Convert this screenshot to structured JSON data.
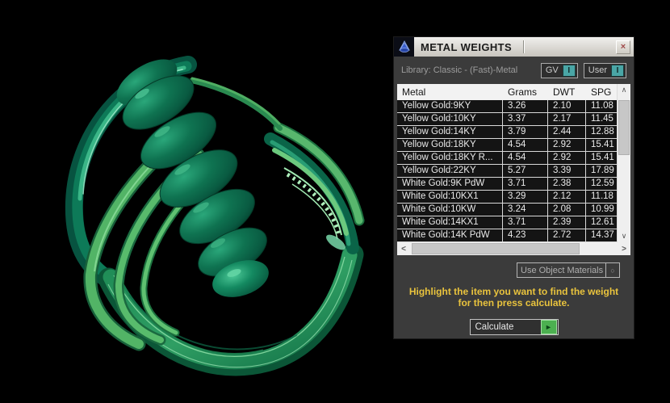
{
  "window": {
    "title": "METAL WEIGHTS"
  },
  "icons": {
    "close": "×",
    "scroll_up": "∧",
    "scroll_down": "∨",
    "scroll_left": "<",
    "scroll_right": ">",
    "dropdown_circle": "○",
    "play": "►",
    "gv_indicator": "I",
    "user_indicator": "I"
  },
  "library": {
    "label": "Library: Classic - (Fast)-Metal"
  },
  "toggles": [
    {
      "label": "GV"
    },
    {
      "label": "User"
    }
  ],
  "table": {
    "columns": [
      "Metal",
      "Grams",
      "DWT",
      "SPG"
    ],
    "rows": [
      [
        "Yellow Gold:9KY",
        "3.26",
        "2.10",
        "11.08"
      ],
      [
        "Yellow Gold:10KY",
        "3.37",
        "2.17",
        "11.45"
      ],
      [
        "Yellow Gold:14KY",
        "3.79",
        "2.44",
        "12.88"
      ],
      [
        "Yellow Gold:18KY",
        "4.54",
        "2.92",
        "15.41"
      ],
      [
        "Yellow Gold:18KY R...",
        "4.54",
        "2.92",
        "15.41"
      ],
      [
        "Yellow Gold:22KY",
        "5.27",
        "3.39",
        "17.89"
      ],
      [
        "White Gold:9K PdW",
        "3.71",
        "2.38",
        "12.59"
      ],
      [
        "White Gold:10KX1",
        "3.29",
        "2.12",
        "11.18"
      ],
      [
        "White Gold:10KW",
        "3.24",
        "2.08",
        "10.99"
      ],
      [
        "White Gold:14KX1",
        "3.71",
        "2.39",
        "12.61"
      ],
      [
        "White Gold:14K PdW",
        "4.23",
        "2.72",
        "14.37"
      ]
    ]
  },
  "materials_dropdown": {
    "value": "Use Object Materials"
  },
  "instruction": {
    "line1": "Highlight the item you want to find the weight",
    "line2": "for then press calculate."
  },
  "calculate_button": {
    "label": "Calculate"
  },
  "model": {
    "description": "green 3D ring CAD render",
    "primary_color": "#0e7351",
    "ribbon_color": "#52b466"
  },
  "colors": {
    "dialog_bg": "#3b3b3b",
    "titlebar_bg": "#d6d3cc",
    "row_bg": "#141414",
    "accent_teal": "#4aa6a6",
    "instruction_yellow": "#e9c33d",
    "calc_green": "#4cb050"
  }
}
